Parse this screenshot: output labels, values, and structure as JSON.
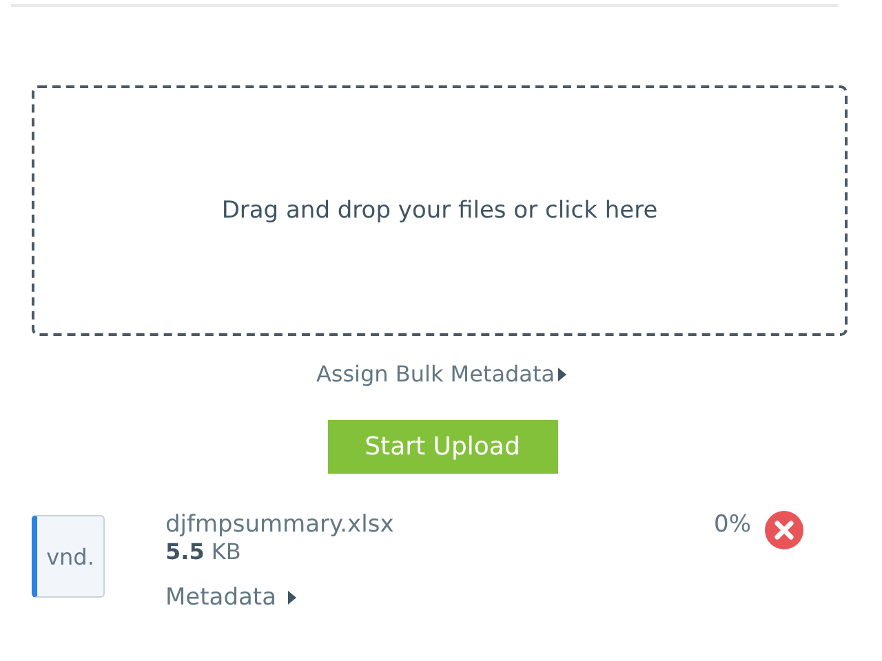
{
  "dropzone": {
    "label": "Drag and drop your files or click here"
  },
  "bulk_metadata": {
    "label": "Assign Bulk Metadata",
    "expanded": false
  },
  "start_button": {
    "label": "Start Upload"
  },
  "files": [
    {
      "type_label": "vnd.",
      "name": "djfmpsummary.xlsx",
      "size": "**5.5** KB",
      "progress": "0%",
      "metadata": {
        "label": "Metadata",
        "expanded": false
      }
    }
  ]
}
